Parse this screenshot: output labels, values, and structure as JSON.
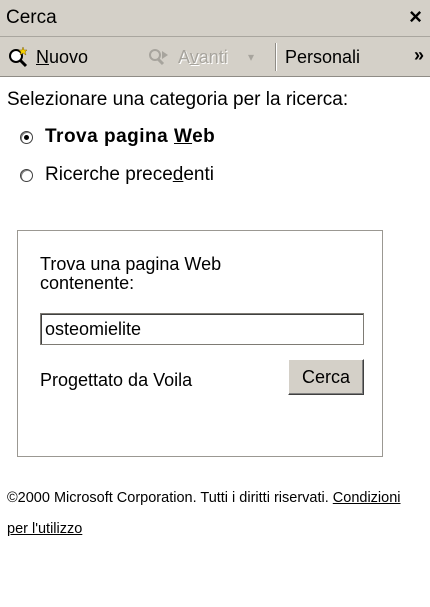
{
  "panel": {
    "title": "Cerca",
    "close_symbol": "×"
  },
  "toolbar": {
    "new_label": "Nuovo",
    "next_label": "Avanti",
    "personalize_label": "Personali",
    "more_symbol": "»"
  },
  "search": {
    "prompt": "Selezionare una categoria per la ricerca:",
    "categories": [
      {
        "label": "Trova pagina Web",
        "selected": true
      },
      {
        "label": "Ricerche precedenti",
        "selected": false
      }
    ],
    "field_label": "Trova una pagina Web contenente:",
    "query_value": "osteomielite",
    "credit": "Progettato da Voila",
    "button_label": "Cerca"
  },
  "footer": {
    "copyright": "©2000 Microsoft Corporation. Tutti i diritti riservati.",
    "terms_link": "Condizioni per l'utilizzo"
  },
  "colors": {
    "chrome": "#d4d0c8",
    "disabled_text": "#a7a49d"
  }
}
